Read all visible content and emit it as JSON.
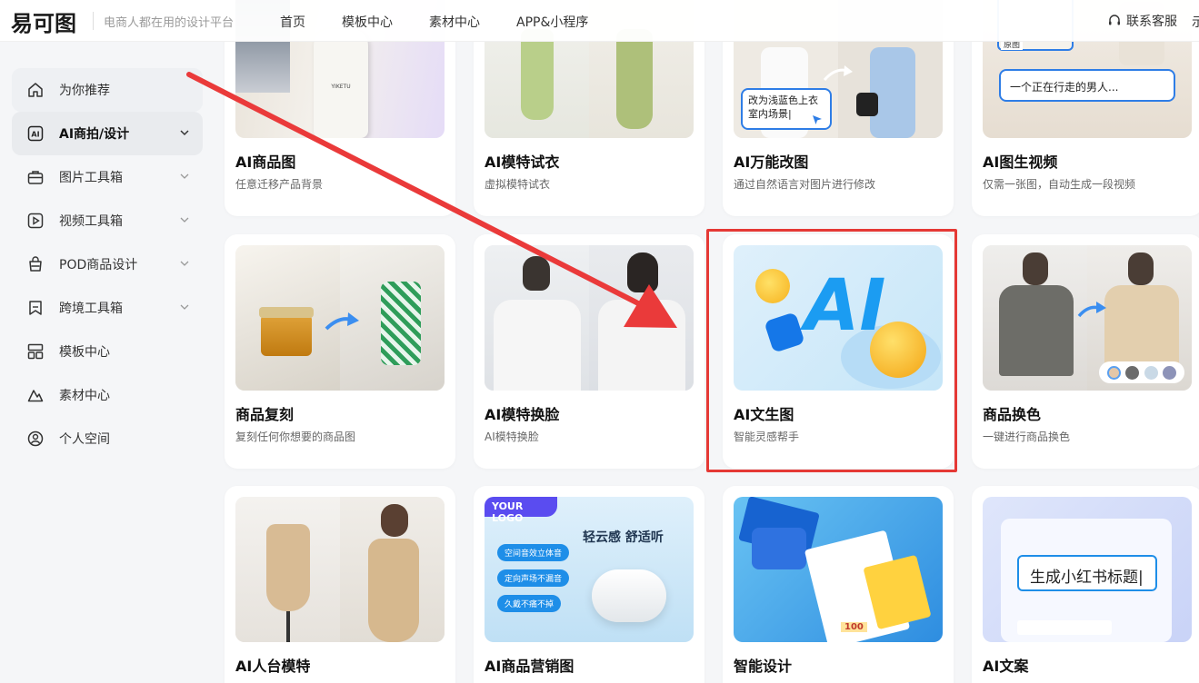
{
  "header": {
    "logo": "易可图",
    "tagline": "电商人都在用的设计平台",
    "nav": [
      "首页",
      "模板中心",
      "素材中心",
      "APP&小程序"
    ],
    "contact": "联系客服",
    "extra": "示"
  },
  "sidebar": {
    "items": [
      {
        "label": "为你推荐",
        "icon": "home-icon"
      },
      {
        "label": "AI商拍/设计",
        "icon": "ai-icon"
      },
      {
        "label": "图片工具箱",
        "icon": "toolbox-icon"
      },
      {
        "label": "视频工具箱",
        "icon": "video-icon"
      },
      {
        "label": "POD商品设计",
        "icon": "bag-icon"
      },
      {
        "label": "跨境工具箱",
        "icon": "bookmark-icon"
      },
      {
        "label": "模板中心",
        "icon": "template-icon"
      },
      {
        "label": "素材中心",
        "icon": "material-icon"
      },
      {
        "label": "个人空间",
        "icon": "user-icon"
      }
    ]
  },
  "cards": {
    "row1": [
      {
        "title": "AI商品图",
        "desc": "任意迁移产品背景"
      },
      {
        "title": "AI模特试衣",
        "desc": "虚拟模特试衣"
      },
      {
        "title": "AI万能改图",
        "desc": "通过自然语言对图片进行修改"
      },
      {
        "title": "AI图生视频",
        "desc": "仅需一张图，自动生成一段视频"
      }
    ],
    "row2": [
      {
        "title": "商品复刻",
        "desc": "复刻任何你想要的商品图"
      },
      {
        "title": "AI模特换脸",
        "desc": "AI模特换脸"
      },
      {
        "title": "AI文生图",
        "desc": "智能灵感帮手"
      },
      {
        "title": "商品换色",
        "desc": "一键进行商品换色"
      }
    ],
    "row3": [
      {
        "title": "AI人台模特"
      },
      {
        "title": "AI商品营销图"
      },
      {
        "title": "智能设计"
      },
      {
        "title": "AI文案"
      }
    ]
  },
  "thumbs": {
    "bottle_label": "YIKETU",
    "edit_prompt": "改为浅蓝色上衣室内场景|",
    "original_tag": "原图",
    "video_prompt": "一个正在行走的男人...",
    "ai_text": "AI",
    "marketing_logo": "YOUR LOGO",
    "marketing_headline": "轻云感 舒适听",
    "marketing_pills": [
      "空间音效立体音",
      "定向声场不漏音",
      "久戴不痛不掉"
    ],
    "copy_input": "生成小红书标题|",
    "design_badge": "100"
  },
  "colors": {
    "accent_red": "#e53935",
    "brand_blue": "#1e8ee8",
    "swatches": [
      "#e4c7a8",
      "#6b6b6b",
      "#c9d9e6",
      "#8d93b8"
    ]
  }
}
